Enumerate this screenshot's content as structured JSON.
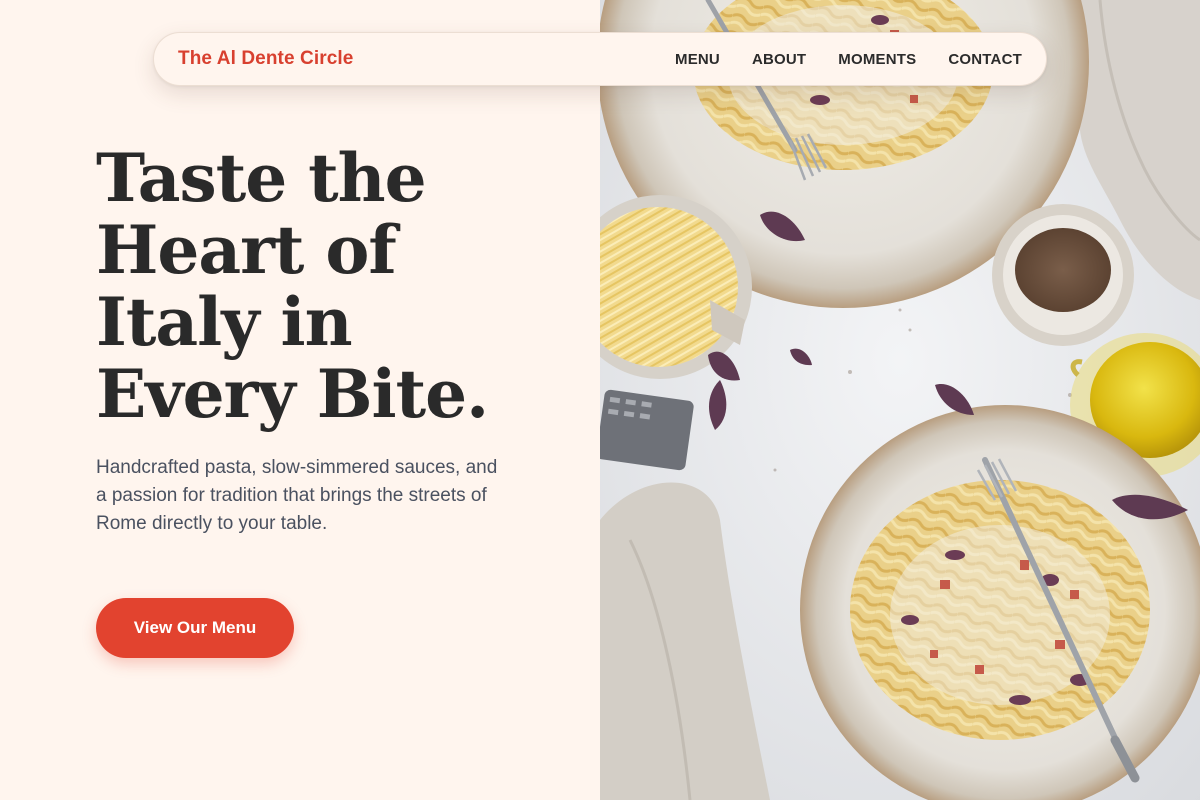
{
  "brand": {
    "name": "The Al Dente Circle"
  },
  "nav": {
    "items": [
      {
        "label": "MENU"
      },
      {
        "label": "ABOUT"
      },
      {
        "label": "MOMENTS"
      },
      {
        "label": "CONTACT"
      }
    ]
  },
  "hero": {
    "title_lines": [
      "Taste the",
      "Heart of",
      "Italy in",
      "Every Bite."
    ],
    "subtitle": "Handcrafted pasta, slow-simmered sauces, and a passion for tradition that brings the streets of Rome directly to your table.",
    "cta_label": "View Our Menu"
  },
  "colors": {
    "accent": "#E2432F",
    "brand_text": "#D8402F",
    "background": "#FFF5EE",
    "heading": "#2A2A2A",
    "body_text": "#4A5160"
  },
  "icons": {
    "hero_image": "pasta-dishes-photo"
  }
}
